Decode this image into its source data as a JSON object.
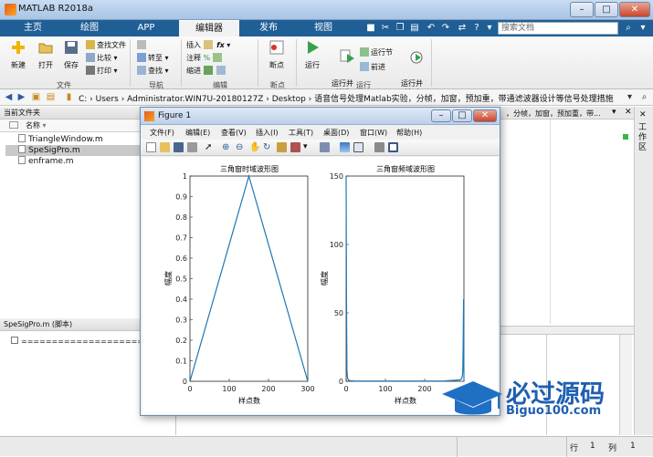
{
  "window": {
    "title": "MATLAB R2018a"
  },
  "tabs": [
    {
      "label": "主页",
      "active": false
    },
    {
      "label": "绘图",
      "active": false
    },
    {
      "label": "APP",
      "active": false
    },
    {
      "label": "编辑器",
      "active": true
    },
    {
      "label": "发布",
      "active": false
    },
    {
      "label": "视图",
      "active": false
    }
  ],
  "search": {
    "placeholder": "搜索文档"
  },
  "ribbon": {
    "file_group": {
      "new": "新建",
      "open": "打开",
      "save": "保存",
      "find_files": "查找文件",
      "compare": "比较",
      "print": "打印",
      "label": "文件"
    },
    "nav_group": {
      "goto": "转至",
      "find": "查找",
      "label": "导航"
    },
    "edit_group": {
      "insert": "插入",
      "comment": "注释",
      "indent": "缩进",
      "label": "编辑"
    },
    "breakpoint_group": {
      "breakpoints": "断点",
      "label": "断点"
    },
    "run_group": {
      "run": "运行",
      "run_advance": "运行并\n前进",
      "run_section": "运行节",
      "advance": "前进",
      "run_time": "运行并\n计时",
      "label": "运行"
    }
  },
  "address": {
    "path": "C: › Users › Administrator.WIN7U-20180127Z › Desktop › 语音信号处理Matlab实验，分帧，加窗，预加重，带通滤波器设计等信号处理措施"
  },
  "current_folder": {
    "title": "当前文件夹",
    "column": "名称",
    "files": [
      "TriangleWindow.m",
      "SpeSigPro.m",
      "enframe.m"
    ],
    "selected": "SpeSigPro.m"
  },
  "details": {
    "title": "SpeSigPro.m  (脚本)",
    "content": "================================"
  },
  "editor_tab_text": "，分帧，加窗，预加重，带...",
  "right_panel": {
    "label": "工作区"
  },
  "status": {
    "row_label": "行",
    "row": "1",
    "col_label": "列",
    "col": "1"
  },
  "figure": {
    "title": "Figure 1",
    "menu": [
      "文件(F)",
      "编辑(E)",
      "查看(V)",
      "插入(I)",
      "工具(T)",
      "桌面(D)",
      "窗口(W)",
      "帮助(H)"
    ]
  },
  "chart_data": [
    {
      "type": "line",
      "title": "三角窗时域波形图",
      "xlabel": "样点数",
      "ylabel": "幅度",
      "xlim": [
        0,
        300
      ],
      "ylim": [
        0,
        1
      ],
      "xticks": [
        "0",
        "100",
        "200",
        "300"
      ],
      "yticks": [
        "0",
        "0.1",
        "0.2",
        "0.3",
        "0.4",
        "0.5",
        "0.6",
        "0.7",
        "0.8",
        "0.9",
        "1"
      ],
      "x": [
        0,
        150,
        300
      ],
      "y": [
        0,
        1,
        0
      ],
      "color": "#1f77b4"
    },
    {
      "type": "line",
      "title": "三角窗频域波形图",
      "xlabel": "样点数",
      "ylabel": "幅度",
      "xlim": [
        0,
        300
      ],
      "ylim": [
        0,
        150
      ],
      "xticks": [
        "0",
        "100",
        "200"
      ],
      "yticks": [
        "0",
        "50",
        "100",
        "150"
      ],
      "x": [
        0,
        1,
        2,
        3,
        4,
        6,
        10,
        20,
        50,
        100,
        150,
        200,
        250,
        290,
        294,
        296,
        297,
        298,
        299,
        300
      ],
      "y": [
        150,
        60,
        8,
        4,
        2,
        1,
        0.5,
        0.3,
        0.2,
        0.2,
        0.2,
        0.2,
        0.3,
        1,
        2,
        4,
        8,
        25,
        60,
        0
      ],
      "color": "#1f77b4"
    }
  ],
  "watermark": {
    "text": "必过源码",
    "url": "Biguo100.com"
  },
  "colors": {
    "tab_strip": "#1f5f96",
    "line": "#1f77b4"
  }
}
